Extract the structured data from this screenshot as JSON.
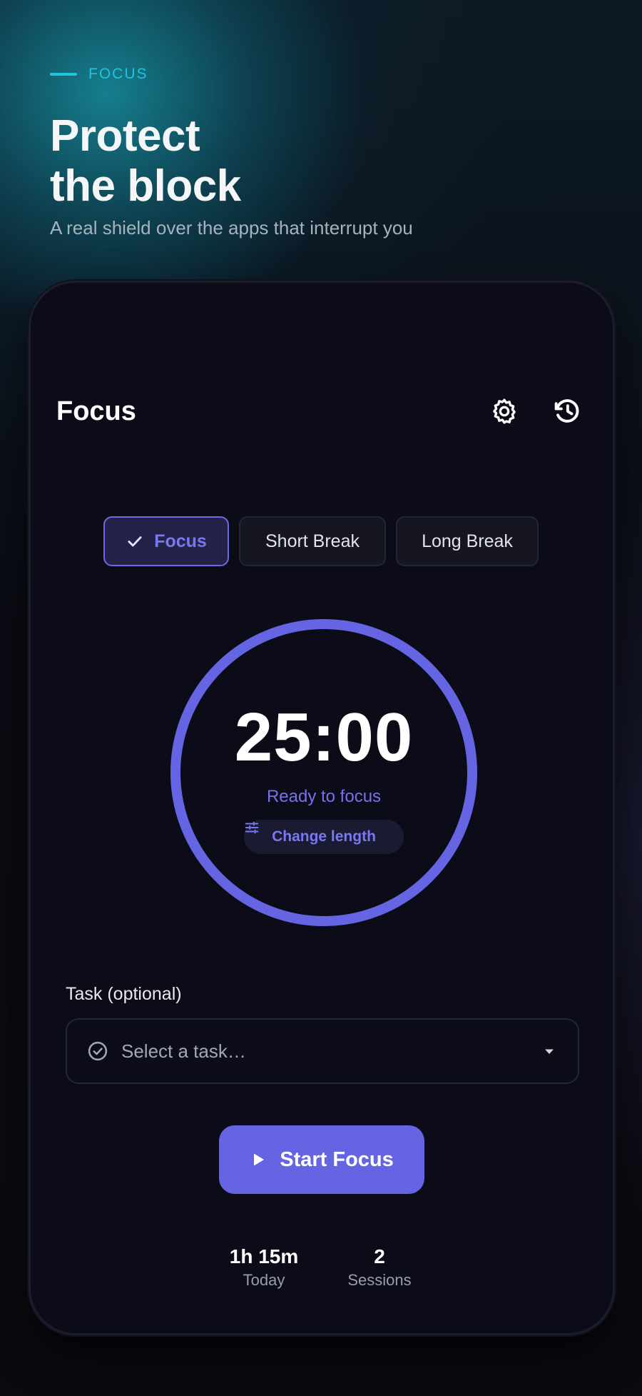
{
  "hero": {
    "eyebrow": "FOCUS",
    "title_line1": "Protect",
    "title_line2": "the block",
    "subtitle": "A real shield over the apps that interrupt you"
  },
  "header": {
    "title": "Focus",
    "settings_icon": "gear-icon",
    "history_icon": "history-icon"
  },
  "modes": {
    "selected": "Focus",
    "items": [
      {
        "label": "Focus",
        "active": true
      },
      {
        "label": "Short Break",
        "active": false
      },
      {
        "label": "Long Break",
        "active": false
      }
    ]
  },
  "timer": {
    "time": "25:00",
    "status": "Ready to focus",
    "progress": 1.0,
    "change_length_label": "Change length"
  },
  "task": {
    "label": "Task (optional)",
    "placeholder": "Select a task…"
  },
  "start_button": {
    "label": "Start Focus"
  },
  "stats": {
    "today_value": "1h 15m",
    "today_label": "Today",
    "sessions_value": "2",
    "sessions_label": "Sessions"
  },
  "colors": {
    "accent": "#6565e4",
    "teal": "#22c4dc",
    "background": "#0b0c18"
  }
}
